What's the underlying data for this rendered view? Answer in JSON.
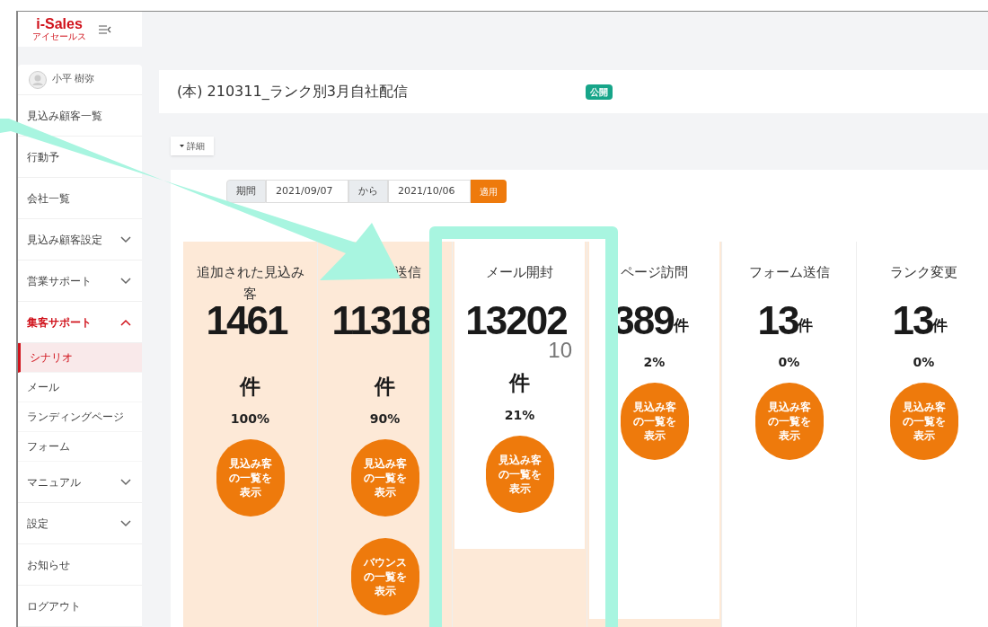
{
  "logo": {
    "text": "i-Sales",
    "subtext": "アイセールス"
  },
  "sidebar": {
    "user": "小平 樹弥",
    "items": [
      {
        "label": "見込み顧客一覧",
        "expandable": false,
        "expanded": false
      },
      {
        "label": "行動予",
        "expandable": false,
        "expanded": false
      },
      {
        "label": "会社一覧",
        "expandable": false,
        "expanded": false
      },
      {
        "label": "見込み顧客設定",
        "expandable": true,
        "expanded": false
      },
      {
        "label": "営業サポート",
        "expandable": true,
        "expanded": false
      },
      {
        "label": "集客サポート",
        "expandable": true,
        "expanded": true,
        "children": [
          {
            "label": "シナリオ",
            "selected": true
          },
          {
            "label": "メール",
            "selected": false
          },
          {
            "label": "ランディングページ",
            "selected": false
          },
          {
            "label": "フォーム",
            "selected": false
          }
        ]
      },
      {
        "label": "マニュアル",
        "expandable": true,
        "expanded": false
      },
      {
        "label": "設定",
        "expandable": true,
        "expanded": false
      },
      {
        "label": "お知らせ",
        "expandable": false,
        "expanded": false
      },
      {
        "label": "ログアウト",
        "expandable": false,
        "expanded": false
      }
    ]
  },
  "title": "(本) 210311_ランク別3月自社配信",
  "status_badge": "公開",
  "details_toggle": "詳細",
  "period": {
    "label": "期間",
    "from": "2021/09/07",
    "separator": "から",
    "to": "2021/10/06",
    "apply": "適用"
  },
  "columns": [
    {
      "kind": "peach",
      "header": "追加された見込み客",
      "count": "1461",
      "unit": "件",
      "unit_inline": false,
      "percent": "100%",
      "buttons": [
        "見込み客の一覧を表示"
      ]
    },
    {
      "kind": "peach",
      "header": "送信",
      "count": "11318",
      "unit": "件",
      "unit_inline": false,
      "percent": "90%",
      "buttons": [
        "見込み客の一覧を表示",
        "バウンスの一覧を表示"
      ]
    },
    {
      "kind": "boxed",
      "header": "メール開封",
      "count": "13202",
      "note": "10",
      "unit": "件",
      "unit_inline": false,
      "percent": "21%",
      "buttons": [
        "見込み客の一覧を表示"
      ]
    },
    {
      "kind": "boxed",
      "header": "ページ訪問",
      "count": "389",
      "unit": "件",
      "unit_inline": true,
      "percent": "2%",
      "buttons": [
        "見込み客の一覧を表示"
      ]
    },
    {
      "kind": "plain",
      "header": "フォーム送信",
      "count": "13",
      "unit": "件",
      "unit_inline": true,
      "percent": "0%",
      "buttons": [
        "見込み客の一覧を表示"
      ]
    },
    {
      "kind": "plain",
      "header": "ランク変更",
      "count": "13",
      "unit": "件",
      "unit_inline": true,
      "percent": "0%",
      "buttons": [
        "見込み客の一覧を表示"
      ]
    }
  ]
}
